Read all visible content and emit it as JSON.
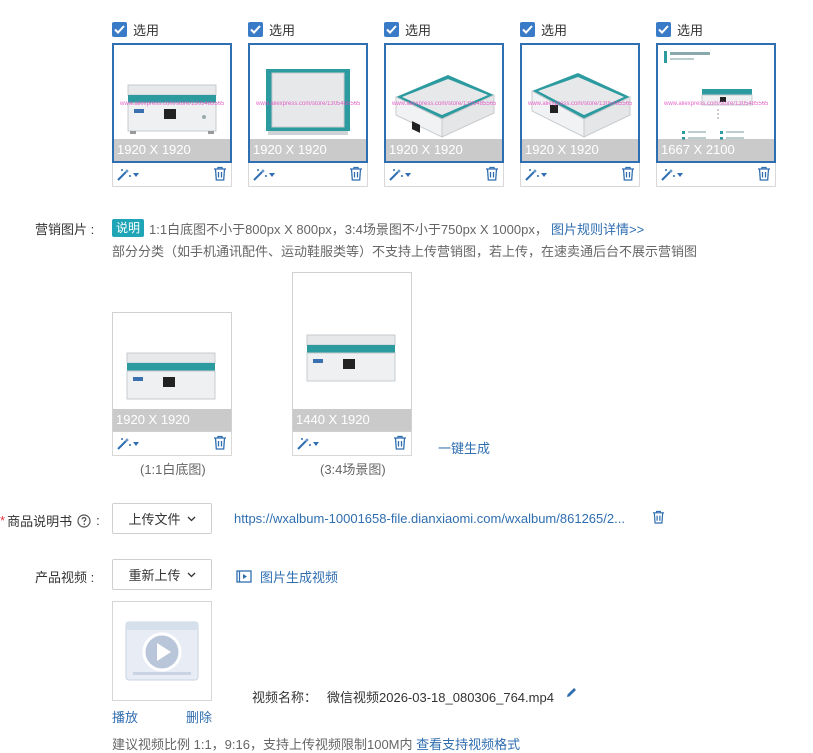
{
  "top_images": [
    {
      "checkbox_label": "选用",
      "dimension": "1920 X 1920",
      "watermark": "www.aliexpress.com/store/1305485565"
    },
    {
      "checkbox_label": "选用",
      "dimension": "1920 X 1920",
      "watermark": "www.aliexpress.com/store/1305485565"
    },
    {
      "checkbox_label": "选用",
      "dimension": "1920 X 1920",
      "watermark": "www.aliexpress.com/store/1305485565"
    },
    {
      "checkbox_label": "选用",
      "dimension": "1920 X 1920",
      "watermark": "www.aliexpress.com/store/1305485565"
    },
    {
      "checkbox_label": "选用",
      "dimension": "1667 X 2100",
      "watermark": "www.aliexpress.com/store/1305485565"
    }
  ],
  "marketing": {
    "label": "营销图片 :",
    "badge": "说明",
    "rule_text": "1:1白底图不小于800px X 800px，3:4场景图不小于750px X 1000px，",
    "rule_link": "图片规则详情>>",
    "note": "部分分类（如手机通讯配件、运动鞋服类等）不支持上传营销图，若上传，在速卖通后台不展示营销图",
    "images": [
      {
        "dimension": "1920 X 1920",
        "caption": "(1:1白底图)"
      },
      {
        "dimension": "1440 X 1920",
        "caption": "(3:4场景图)"
      }
    ],
    "generate_link": "一键生成"
  },
  "manual": {
    "required_mark": "*",
    "label": "商品说明书",
    "help_icon": "question-circle-icon",
    "upload_button": "上传文件",
    "file_url": "https://wxalbum-10001658-file.dianxiaomi.com/wxalbum/861265/2..."
  },
  "video": {
    "label": "产品视频 :",
    "reupload_button": "重新上传",
    "generate_link": "图片生成视频",
    "play_link": "播放",
    "delete_link": "删除",
    "name_label": "视频名称：",
    "name_value": "微信视频2026-03-18_080306_764.mp4",
    "bottom_note": "建议视频比例 1:1，9:16，支持上传视频限制100M内",
    "bottom_link": "查看支持视频格式"
  },
  "colors": {
    "accent": "#2f6eb0",
    "badge": "#1fa5b6",
    "checkbox": "#3a7bc8"
  }
}
